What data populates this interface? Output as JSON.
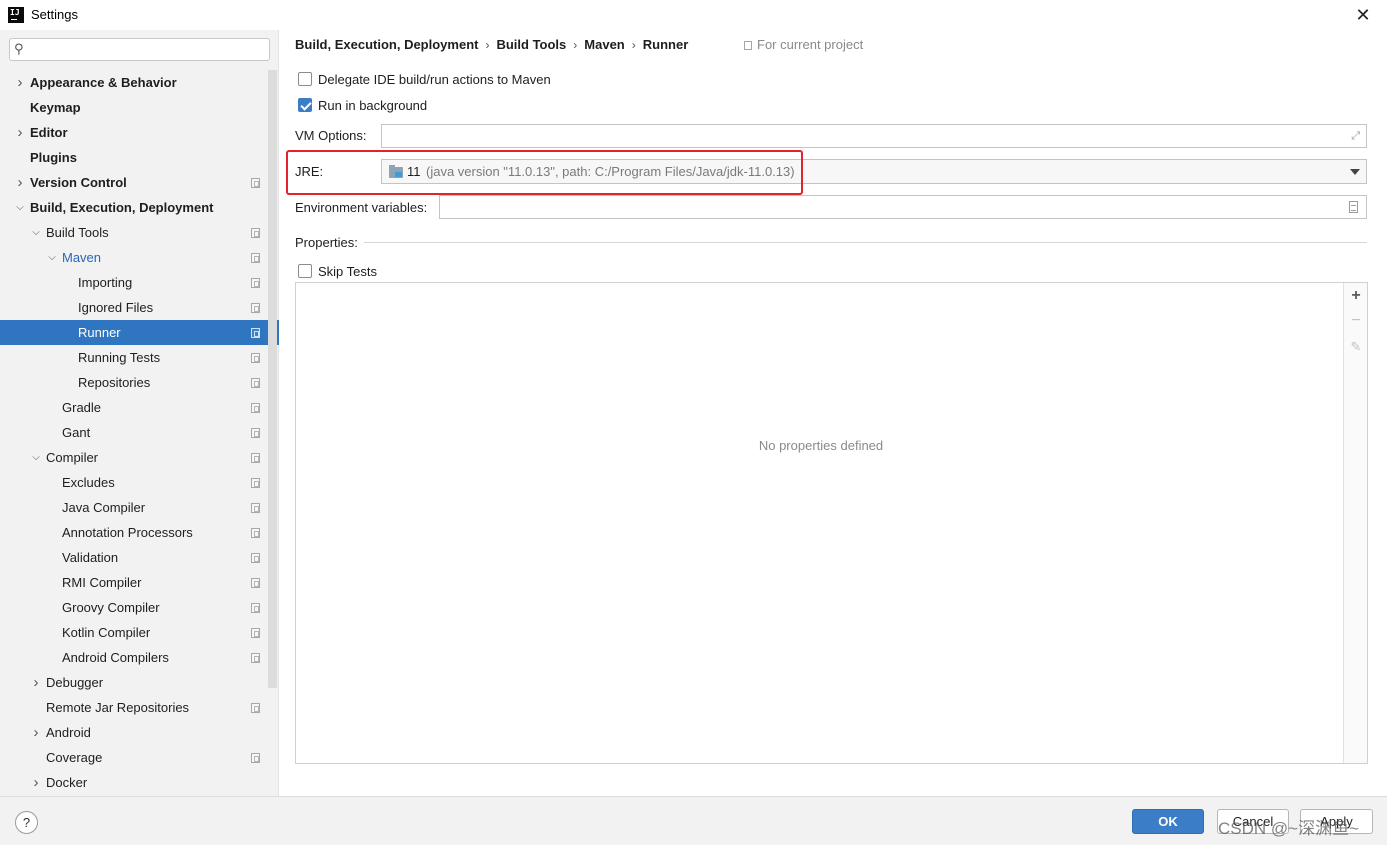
{
  "window": {
    "title": "Settings",
    "close_glyph": "✕"
  },
  "sidebar": {
    "search": {
      "placeholder": "",
      "value": ""
    },
    "items": [
      {
        "label": "Appearance & Behavior",
        "level": 0,
        "bold": true,
        "arrow": "right",
        "proj": false
      },
      {
        "label": "Keymap",
        "level": 0,
        "bold": true,
        "arrow": "none",
        "proj": false
      },
      {
        "label": "Editor",
        "level": 0,
        "bold": true,
        "arrow": "right",
        "proj": false
      },
      {
        "label": "Plugins",
        "level": 0,
        "bold": true,
        "arrow": "none",
        "proj": false
      },
      {
        "label": "Version Control",
        "level": 0,
        "bold": true,
        "arrow": "right",
        "proj": true
      },
      {
        "label": "Build, Execution, Deployment",
        "level": 0,
        "bold": true,
        "arrow": "down",
        "proj": false
      },
      {
        "label": "Build Tools",
        "level": 1,
        "bold": false,
        "arrow": "down",
        "proj": true
      },
      {
        "label": "Maven",
        "level": 2,
        "bold": false,
        "arrow": "down",
        "proj": true,
        "highlight": true
      },
      {
        "label": "Importing",
        "level": 3,
        "bold": false,
        "arrow": "none",
        "proj": true
      },
      {
        "label": "Ignored Files",
        "level": 3,
        "bold": false,
        "arrow": "none",
        "proj": true
      },
      {
        "label": "Runner",
        "level": 3,
        "bold": false,
        "arrow": "none",
        "proj": true,
        "selected": true
      },
      {
        "label": "Running Tests",
        "level": 3,
        "bold": false,
        "arrow": "none",
        "proj": true
      },
      {
        "label": "Repositories",
        "level": 3,
        "bold": false,
        "arrow": "none",
        "proj": true
      },
      {
        "label": "Gradle",
        "level": 2,
        "bold": false,
        "arrow": "none",
        "proj": true
      },
      {
        "label": "Gant",
        "level": 2,
        "bold": false,
        "arrow": "none",
        "proj": true
      },
      {
        "label": "Compiler",
        "level": 1,
        "bold": false,
        "arrow": "down",
        "proj": true
      },
      {
        "label": "Excludes",
        "level": 2,
        "bold": false,
        "arrow": "none",
        "proj": true
      },
      {
        "label": "Java Compiler",
        "level": 2,
        "bold": false,
        "arrow": "none",
        "proj": true
      },
      {
        "label": "Annotation Processors",
        "level": 2,
        "bold": false,
        "arrow": "none",
        "proj": true
      },
      {
        "label": "Validation",
        "level": 2,
        "bold": false,
        "arrow": "none",
        "proj": true
      },
      {
        "label": "RMI Compiler",
        "level": 2,
        "bold": false,
        "arrow": "none",
        "proj": true
      },
      {
        "label": "Groovy Compiler",
        "level": 2,
        "bold": false,
        "arrow": "none",
        "proj": true
      },
      {
        "label": "Kotlin Compiler",
        "level": 2,
        "bold": false,
        "arrow": "none",
        "proj": true
      },
      {
        "label": "Android Compilers",
        "level": 2,
        "bold": false,
        "arrow": "none",
        "proj": true
      },
      {
        "label": "Debugger",
        "level": 1,
        "bold": false,
        "arrow": "right",
        "proj": false
      },
      {
        "label": "Remote Jar Repositories",
        "level": 1,
        "bold": false,
        "arrow": "none",
        "proj": true
      },
      {
        "label": "Android",
        "level": 1,
        "bold": false,
        "arrow": "right",
        "proj": false
      },
      {
        "label": "Coverage",
        "level": 1,
        "bold": false,
        "arrow": "none",
        "proj": true
      },
      {
        "label": "Docker",
        "level": 1,
        "bold": false,
        "arrow": "right",
        "proj": false
      }
    ]
  },
  "breadcrumb": [
    "Build, Execution, Deployment",
    "Build Tools",
    "Maven",
    "Runner"
  ],
  "breadcrumb_sep": "›",
  "for_current_project": "For current project",
  "options": {
    "delegate": {
      "label": "Delegate IDE build/run actions to Maven",
      "checked": false
    },
    "run_in_background": {
      "label": "Run in background",
      "checked": true
    }
  },
  "vm_options": {
    "label": "VM Options:",
    "value": ""
  },
  "jre": {
    "label": "JRE:",
    "version": "11",
    "detail": "(java version \"11.0.13\", path: C:/Program Files/Java/jdk-11.0.13)"
  },
  "env_vars": {
    "label": "Environment variables:",
    "value": ""
  },
  "properties": {
    "title": "Properties:",
    "skip_tests": {
      "label": "Skip Tests",
      "checked": false
    },
    "empty_text": "No properties defined",
    "toolbar": {
      "add": "+",
      "remove": "−",
      "edit": "✎"
    }
  },
  "footer": {
    "help": "?",
    "ok": "OK",
    "cancel": "Cancel",
    "apply": "Apply",
    "watermark": "CSDN @~深渊鱼~"
  },
  "colors": {
    "accent": "#2f75c0",
    "ok_button": "#3b7ec7",
    "highlight_box": "#e2232a"
  },
  "icons": {
    "search": "search-icon",
    "close": "close-icon",
    "project": "project-scope-icon",
    "folder": "jdk-folder-icon"
  }
}
